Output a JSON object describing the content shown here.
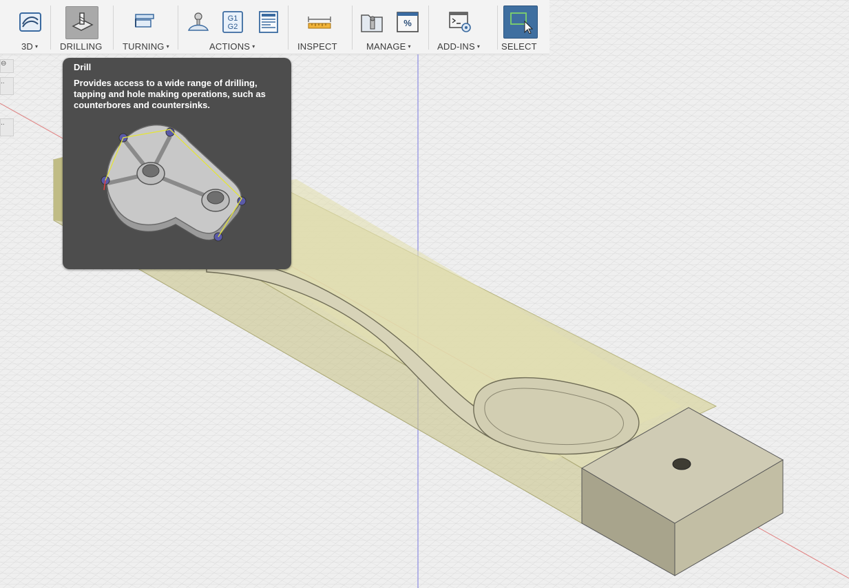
{
  "toolbar": {
    "groups": [
      {
        "label": "3D",
        "has_menu": true
      },
      {
        "label": "DRILLING",
        "has_menu": false
      },
      {
        "label": "TURNING",
        "has_menu": true
      },
      {
        "label": "ACTIONS",
        "has_menu": true
      },
      {
        "label": "INSPECT",
        "has_menu": false
      },
      {
        "label": "MANAGE",
        "has_menu": true
      },
      {
        "label": "ADD-INS",
        "has_menu": true
      },
      {
        "label": "SELECT",
        "has_menu": false
      }
    ],
    "gcode_icon_text": [
      "G1",
      "G2"
    ],
    "percent_icon_text": "%",
    "caret": "▾"
  },
  "tooltip": {
    "title": "Drill",
    "description": "Provides access to a wide range of drilling, tapping and hole making operations, such as counterbores and countersinks."
  },
  "left_panel": {
    "items": [
      "⊖",
      "..",
      ".."
    ]
  },
  "colors": {
    "toolbar_bg": "#f3f3f3",
    "tooltip_bg": "#4d4d4d",
    "select_active": "#3f6fa0",
    "stock": "#d6d3a2",
    "part": "#cfcbb6",
    "axis_red": "#e06060",
    "axis_blue": "#7070d0"
  }
}
